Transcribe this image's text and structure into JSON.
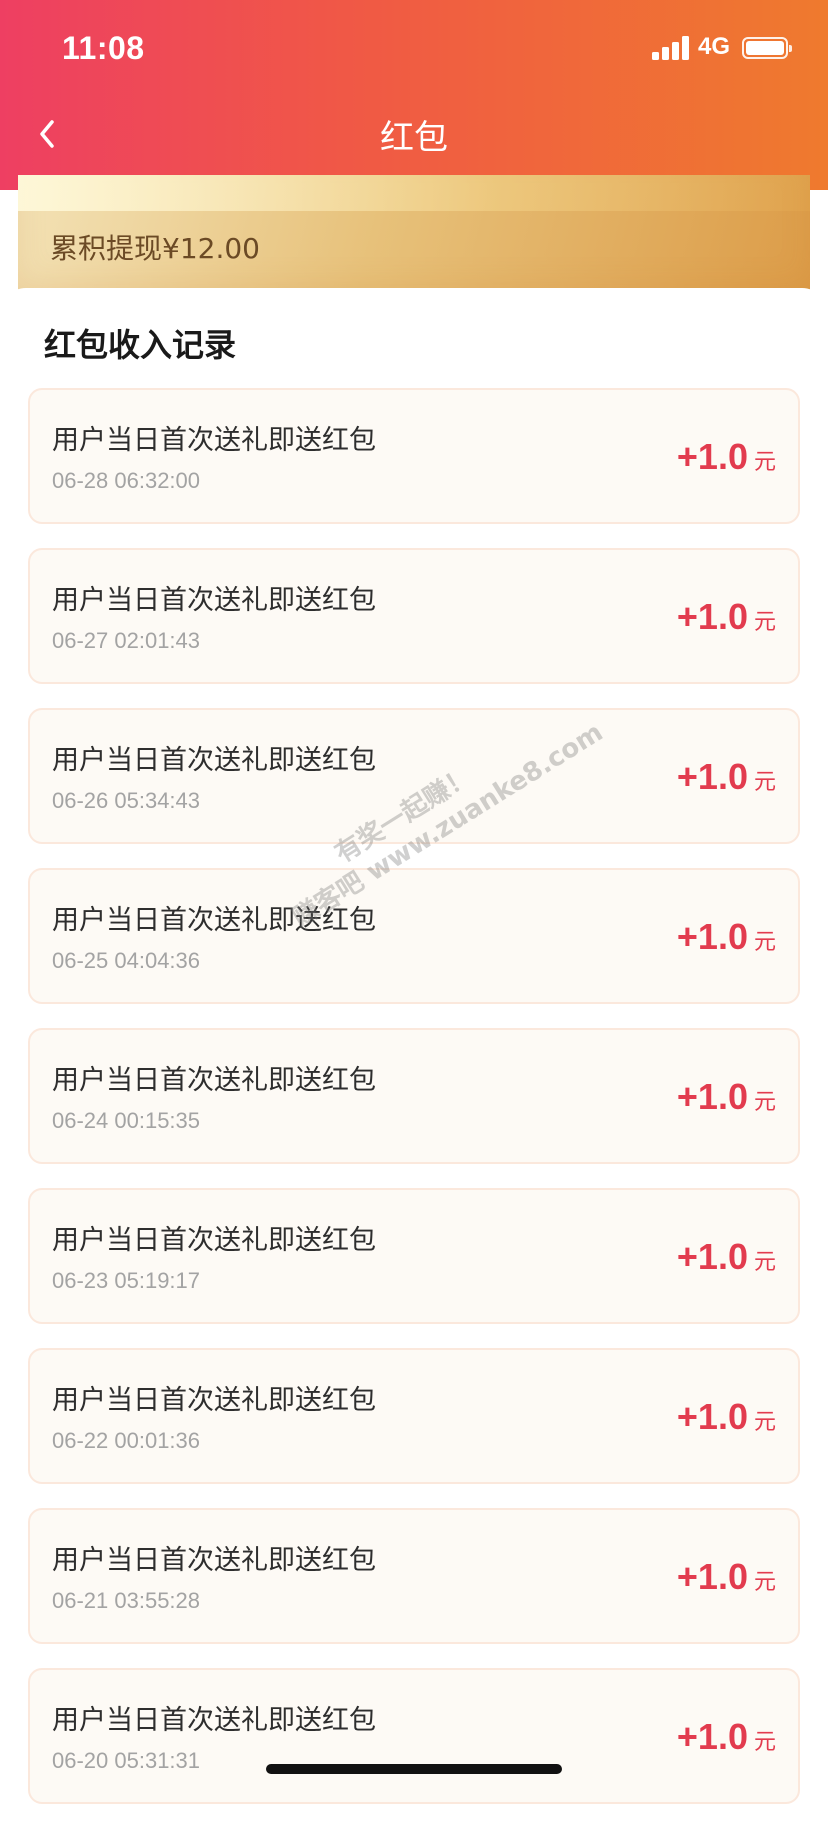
{
  "status_bar": {
    "time": "11:08",
    "network": "4G"
  },
  "nav": {
    "title": "红包"
  },
  "summary": {
    "total_label": "累积提现¥12.00"
  },
  "section": {
    "title": "红包收入记录"
  },
  "records": [
    {
      "title": "用户当日首次送礼即送红包",
      "time": "06-28 06:32:00",
      "amount": "+1.0",
      "unit": "元"
    },
    {
      "title": "用户当日首次送礼即送红包",
      "time": "06-27 02:01:43",
      "amount": "+1.0",
      "unit": "元"
    },
    {
      "title": "用户当日首次送礼即送红包",
      "time": "06-26 05:34:43",
      "amount": "+1.0",
      "unit": "元"
    },
    {
      "title": "用户当日首次送礼即送红包",
      "time": "06-25 04:04:36",
      "amount": "+1.0",
      "unit": "元"
    },
    {
      "title": "用户当日首次送礼即送红包",
      "time": "06-24 00:15:35",
      "amount": "+1.0",
      "unit": "元"
    },
    {
      "title": "用户当日首次送礼即送红包",
      "time": "06-23 05:19:17",
      "amount": "+1.0",
      "unit": "元"
    },
    {
      "title": "用户当日首次送礼即送红包",
      "time": "06-22 00:01:36",
      "amount": "+1.0",
      "unit": "元"
    },
    {
      "title": "用户当日首次送礼即送红包",
      "time": "06-21 03:55:28",
      "amount": "+1.0",
      "unit": "元"
    },
    {
      "title": "用户当日首次送礼即送红包",
      "time": "06-20 05:31:31",
      "amount": "+1.0",
      "unit": "元"
    }
  ],
  "watermark": {
    "line1": "有奖一起赚！",
    "line2": "赚客吧 www.zuanke8.com"
  },
  "colors": {
    "header_start": "#ee3f62",
    "header_end": "#ef7a2e",
    "amount": "#e23b4e",
    "card_gold": "#e7c17a"
  }
}
